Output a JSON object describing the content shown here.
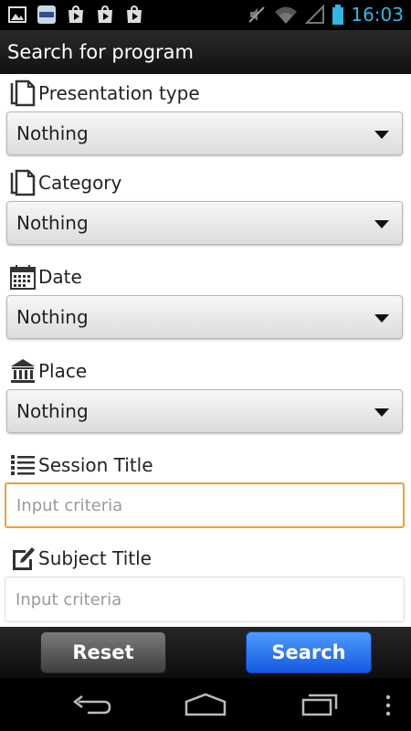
{
  "status_bar": {
    "time": "16:03",
    "icons": [
      "gallery-icon",
      "app-icon",
      "play-store-icon",
      "play-store-icon",
      "play-store-icon",
      "mute-icon",
      "wifi-icon",
      "signal-icon",
      "battery-icon"
    ]
  },
  "app": {
    "title": "Search for program"
  },
  "form": {
    "presentation_type": {
      "label": "Presentation type",
      "value": "Nothing",
      "icon": "document-icon"
    },
    "category": {
      "label": "Category",
      "value": "Nothing",
      "icon": "document-icon"
    },
    "date": {
      "label": "Date",
      "value": "Nothing",
      "icon": "calendar-icon"
    },
    "place": {
      "label": "Place",
      "value": "Nothing",
      "icon": "building-icon"
    },
    "session_title": {
      "label": "Session Title",
      "placeholder": "Input criteria",
      "icon": "list-icon"
    },
    "subject_title": {
      "label": "Subject Title",
      "placeholder": "Input criteria",
      "icon": "edit-icon"
    }
  },
  "actions": {
    "reset_label": "Reset",
    "search_label": "Search"
  },
  "colors": {
    "accent": "#33b5e5",
    "focus": "#f0a030",
    "search_button": "#1f66ea"
  }
}
